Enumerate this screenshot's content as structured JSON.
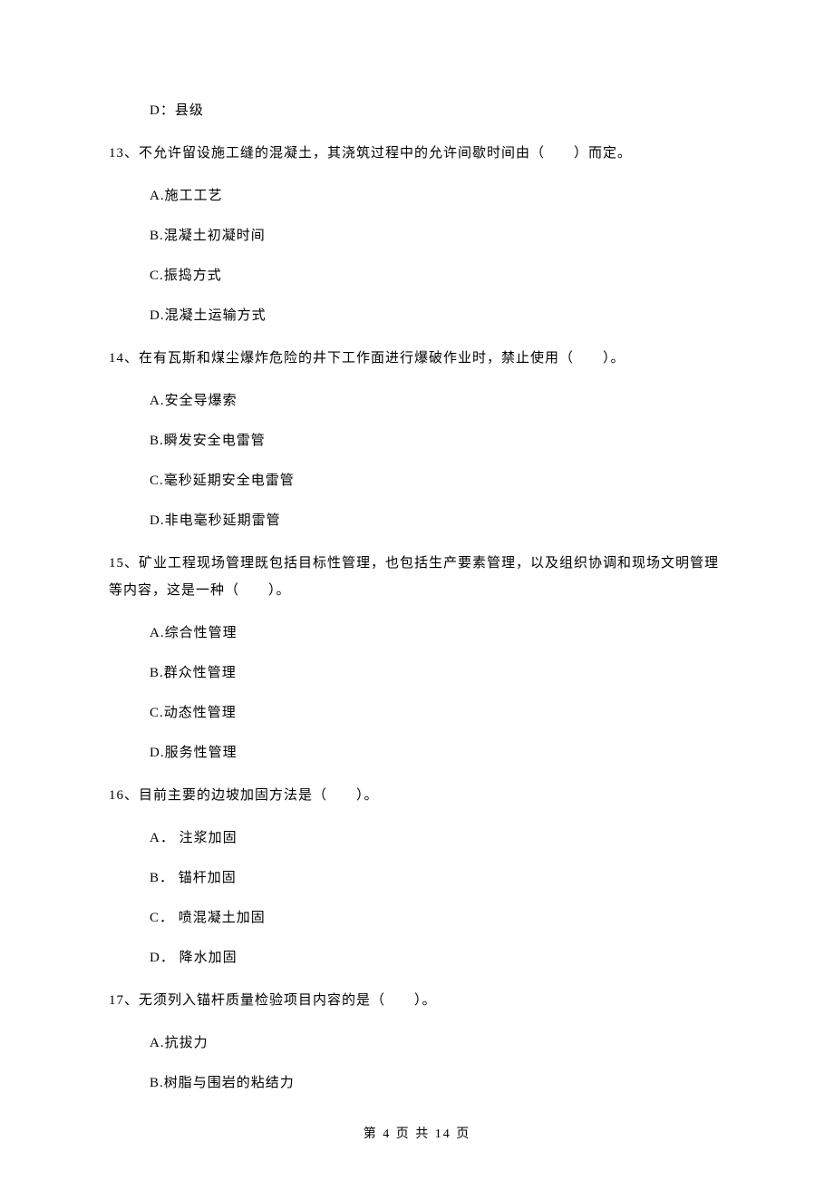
{
  "q12_optD": "D：县级",
  "q13": {
    "text": "13、不允许留设施工缝的混凝土，其浇筑过程中的允许间歇时间由（　　）而定。",
    "optA": "A.施工工艺",
    "optB": "B.混凝土初凝时间",
    "optC": "C.振捣方式",
    "optD": "D.混凝土运输方式"
  },
  "q14": {
    "text": "14、在有瓦斯和煤尘爆炸危险的井下工作面进行爆破作业时，禁止使用（　　）。",
    "optA": "A.安全导爆索",
    "optB": "B.瞬发安全电雷管",
    "optC": "C.毫秒延期安全电雷管",
    "optD": "D.非电毫秒延期雷管"
  },
  "q15": {
    "text": "15、矿业工程现场管理既包括目标性管理，也包括生产要素管理，以及组织协调和现场文明管理等内容，这是一种（　　）。",
    "optA": "A.综合性管理",
    "optB": "B.群众性管理",
    "optC": "C.动态性管理",
    "optD": "D.服务性管理"
  },
  "q16": {
    "text": "16、目前主要的边坡加固方法是（　　）。",
    "optA": "A． 注浆加固",
    "optB": "B． 锚杆加固",
    "optC": "C． 喷混凝土加固",
    "optD": "D． 降水加固"
  },
  "q17": {
    "text": "17、无须列入锚杆质量检验项目内容的是（　　）。",
    "optA": "A.抗拔力",
    "optB": "B.树脂与围岩的粘结力"
  },
  "footer": "第 4 页 共 14 页"
}
